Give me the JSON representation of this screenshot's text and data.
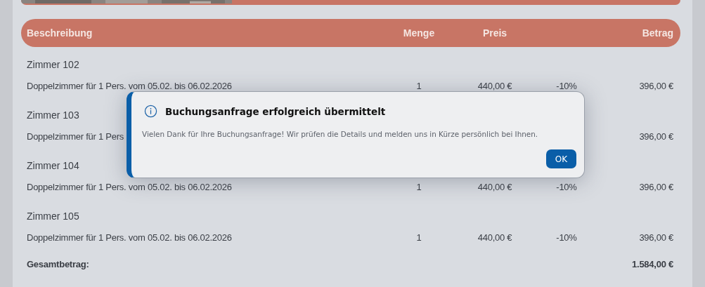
{
  "table": {
    "headers": {
      "description": "Beschreibung",
      "quantity": "Menge",
      "price": "Preis",
      "amount": "Betrag"
    },
    "rooms": [
      {
        "name": "Zimmer 102",
        "description": "Doppelzimmer für 1 Pers. vom 05.02. bis 06.02.2026",
        "quantity": "1",
        "price": "440,00 €",
        "discount": "-10%",
        "amount": "396,00 €"
      },
      {
        "name": "Zimmer 103",
        "description": "Doppelzimmer für 1 Pers",
        "amount": "396,00 €"
      },
      {
        "name": "Zimmer 104",
        "description": "Doppelzimmer für 1 Pers. vom 05.02. bis 06.02.2026",
        "quantity": "1",
        "price": "440,00 €",
        "discount": "-10%",
        "amount": "396,00 €"
      },
      {
        "name": "Zimmer 105",
        "description": "Doppelzimmer für 1 Pers. vom 05.02. bis 06.02.2026",
        "quantity": "1",
        "price": "440,00 €",
        "discount": "-10%",
        "amount": "396,00 €"
      }
    ],
    "total": {
      "label": "Gesamtbetrag:",
      "amount": "1.584,00 €"
    }
  },
  "dialog": {
    "title": "Buchungsanfrage erfolgreich übermittelt",
    "message": "Vielen Dank für Ihre Buchungsanfrage! Wir prüfen die Details und melden uns in Kürze persönlich bei Ihnen.",
    "button": "OK"
  }
}
